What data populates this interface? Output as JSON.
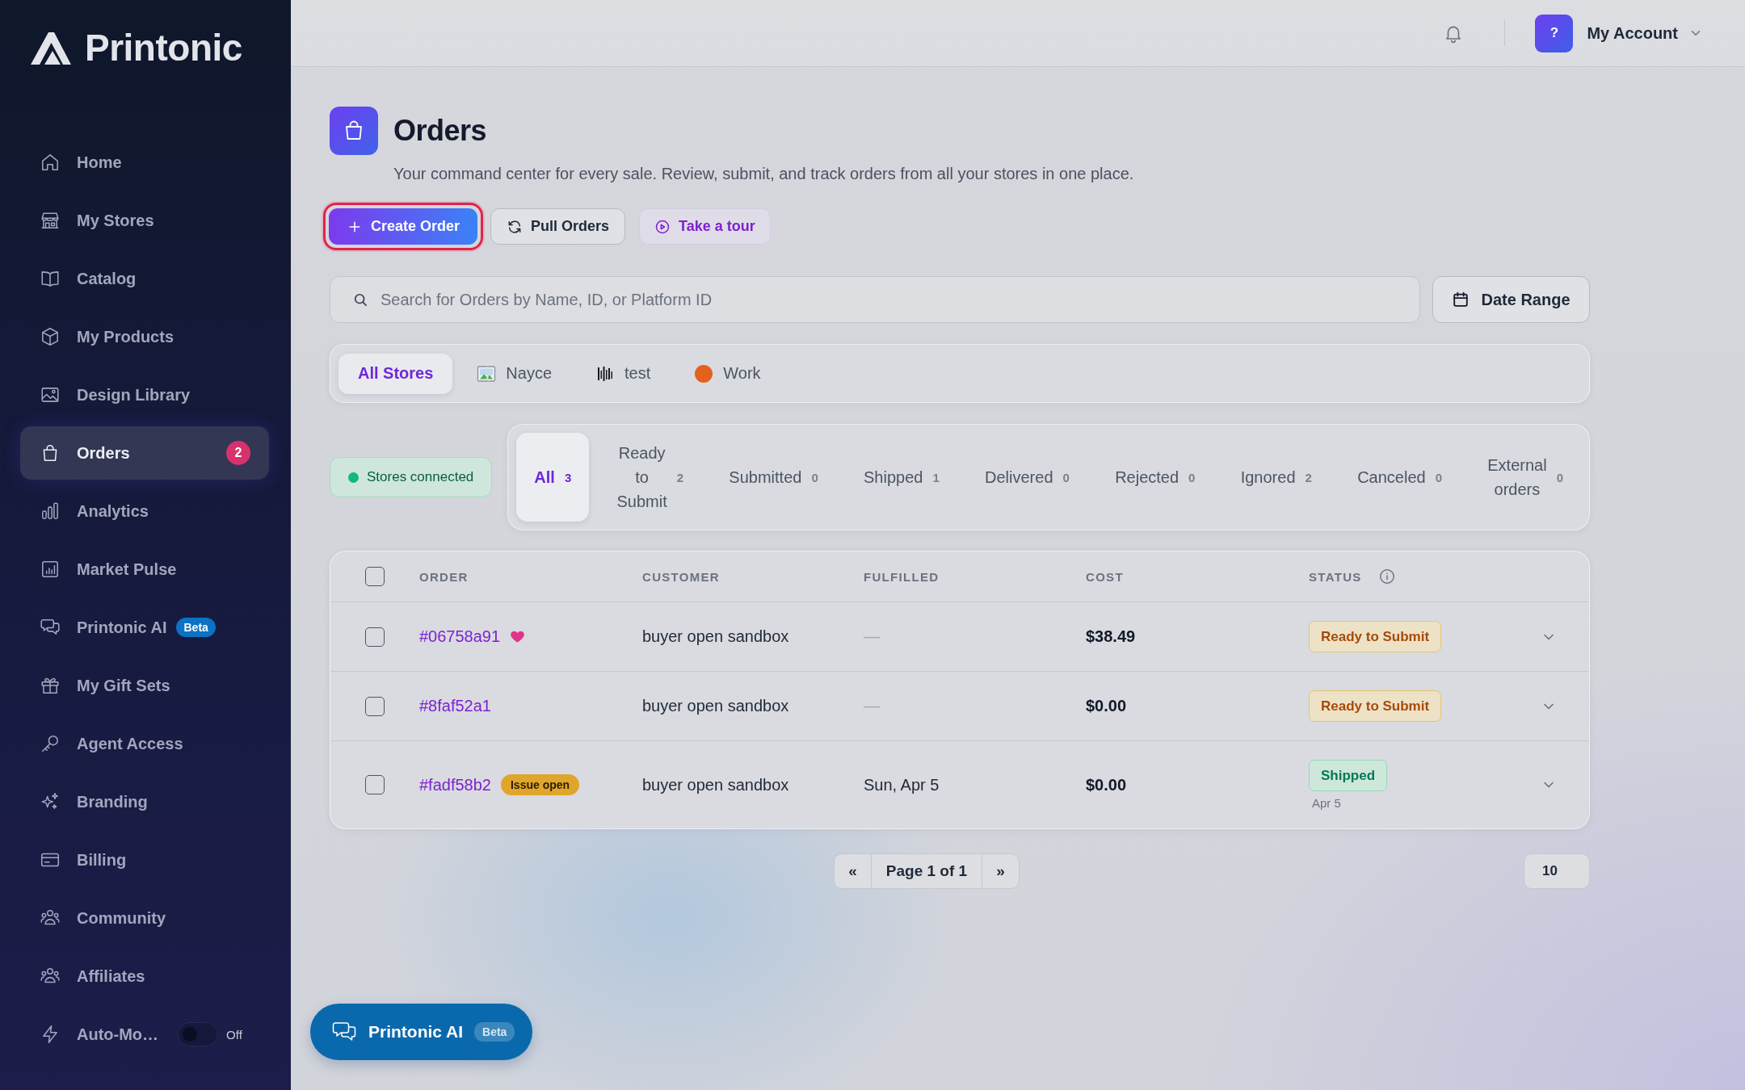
{
  "sidebar": {
    "logo": "Printonic",
    "items": [
      {
        "label": "Home",
        "selected": false
      },
      {
        "label": "My Stores",
        "selected": false
      },
      {
        "label": "Catalog",
        "selected": false
      },
      {
        "label": "My Products",
        "selected": false
      },
      {
        "label": "Design Library",
        "selected": false
      },
      {
        "label": "Orders",
        "selected": true,
        "badge": "2"
      },
      {
        "label": "Analytics",
        "selected": false
      },
      {
        "label": "Market Pulse",
        "selected": false
      },
      {
        "label": "Printonic AI",
        "selected": false,
        "tag": "Beta"
      },
      {
        "label": "My Gift Sets",
        "selected": false
      },
      {
        "label": "Agent Access",
        "selected": false
      },
      {
        "label": "Branding",
        "selected": false
      },
      {
        "label": "Billing",
        "selected": false
      },
      {
        "label": "Community",
        "selected": false
      },
      {
        "label": "Affiliates",
        "selected": false
      },
      {
        "label": "Auto-Mo…",
        "selected": false,
        "toggle": {
          "on": false,
          "label": "Off"
        }
      }
    ]
  },
  "header": {
    "account": {
      "avatar": "?",
      "name": "My Account"
    }
  },
  "page_header": {
    "title": "Orders",
    "subtitle": "Your command center for every sale. Review, submit, and track orders from all your stores in one place."
  },
  "actions": [
    {
      "label": "Create Order",
      "kind": "primary",
      "focused": true
    },
    {
      "label": "Pull Orders",
      "kind": "secondary",
      "focused": false
    },
    {
      "label": "Take a tour",
      "kind": "tour",
      "focused": false
    }
  ],
  "search": {
    "placeholder": "Search for Orders by Name, ID, or Platform ID"
  },
  "date_range": {
    "label": "Date Range"
  },
  "store_tabs": [
    {
      "label": "All Stores",
      "selected": true
    },
    {
      "label": "Nayce",
      "selected": false
    },
    {
      "label": "test",
      "selected": false
    },
    {
      "label": "Work",
      "selected": false
    }
  ],
  "connection": {
    "label": "Stores connected",
    "connected": true
  },
  "status_tabs": [
    {
      "label": "All",
      "count": "3",
      "selected": true
    },
    {
      "label": "Ready to Submit",
      "count": "2",
      "selected": false
    },
    {
      "label": "Submitted",
      "count": "0",
      "selected": false
    },
    {
      "label": "Shipped",
      "count": "1",
      "selected": false
    },
    {
      "label": "Delivered",
      "count": "0",
      "selected": false
    },
    {
      "label": "Rejected",
      "count": "0",
      "selected": false
    },
    {
      "label": "Ignored",
      "count": "2",
      "selected": false
    },
    {
      "label": "Canceled",
      "count": "0",
      "selected": false
    },
    {
      "label": "External orders",
      "count": "0",
      "selected": false
    }
  ],
  "table": {
    "select_all": {
      "checked": false
    },
    "columns": [
      {
        "label": "ORDER",
        "info": false
      },
      {
        "label": "CUSTOMER",
        "info": false
      },
      {
        "label": "FULFILLED",
        "info": false
      },
      {
        "label": "COST",
        "info": false
      },
      {
        "label": "STATUS",
        "info": true
      }
    ],
    "rows": [
      {
        "checked": false,
        "order": "#06758a91",
        "favorite": true,
        "customer": "buyer open sandbox",
        "fulfilled": {
          "text": "—",
          "muted": true
        },
        "cost": "$38.49",
        "status": {
          "label": "Ready to Submit",
          "kind": "ready"
        },
        "expanded": false
      },
      {
        "checked": false,
        "order": "#8faf52a1",
        "favorite": false,
        "customer": "buyer open sandbox",
        "fulfilled": {
          "text": "—",
          "muted": true
        },
        "cost": "$0.00",
        "status": {
          "label": "Ready to Submit",
          "kind": "ready"
        },
        "expanded": false
      },
      {
        "checked": false,
        "order": "#fadf58b2",
        "favorite": false,
        "issue": "Issue open",
        "customer": "buyer open sandbox",
        "fulfilled": {
          "text": "Sun, Apr 5",
          "muted": false
        },
        "cost": "$0.00",
        "status": {
          "label": "Shipped",
          "kind": "shipped",
          "date": "Apr 5"
        },
        "expanded": false
      }
    ]
  },
  "pagination": {
    "first": "«",
    "page": "Page 1 of 1",
    "last": "»"
  },
  "page_size": "10",
  "assistant_button": {
    "label": "Printonic AI",
    "tag": "Beta"
  }
}
